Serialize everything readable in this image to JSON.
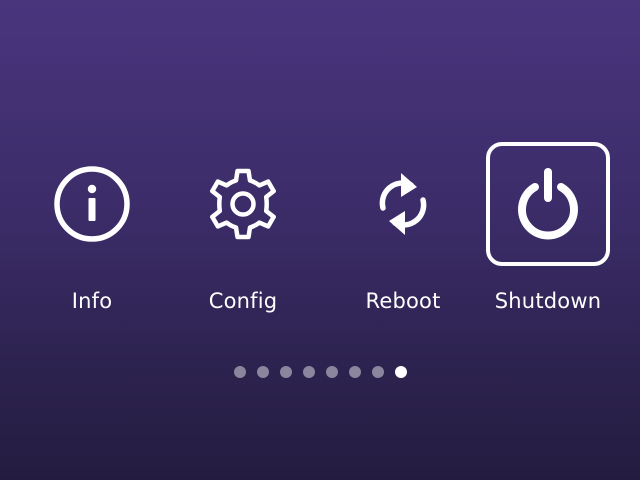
{
  "menu": {
    "items": [
      {
        "label": "Info",
        "icon": "info-icon",
        "selected": false
      },
      {
        "label": "Config",
        "icon": "gear-icon",
        "selected": false
      },
      {
        "label": "Reboot",
        "icon": "refresh-icon",
        "selected": false
      },
      {
        "label": "Shutdown",
        "icon": "power-icon",
        "selected": true
      }
    ]
  },
  "pager": {
    "total": 8,
    "current": 8
  },
  "colors": {
    "background_top": "#49357d",
    "background_bottom": "#241c40",
    "foreground": "#ffffff",
    "dot_inactive": "rgba(255,255,255,0.45)"
  }
}
